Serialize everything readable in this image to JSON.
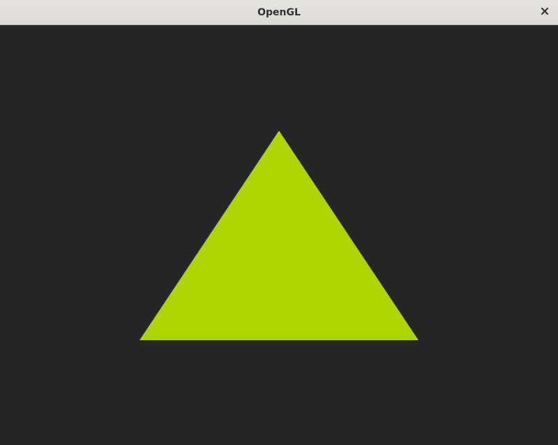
{
  "window": {
    "title": "OpenGL"
  },
  "viewport": {
    "clear_color": "#252525",
    "triangle_color": "#add500"
  },
  "icons": {
    "close": "close-icon"
  }
}
